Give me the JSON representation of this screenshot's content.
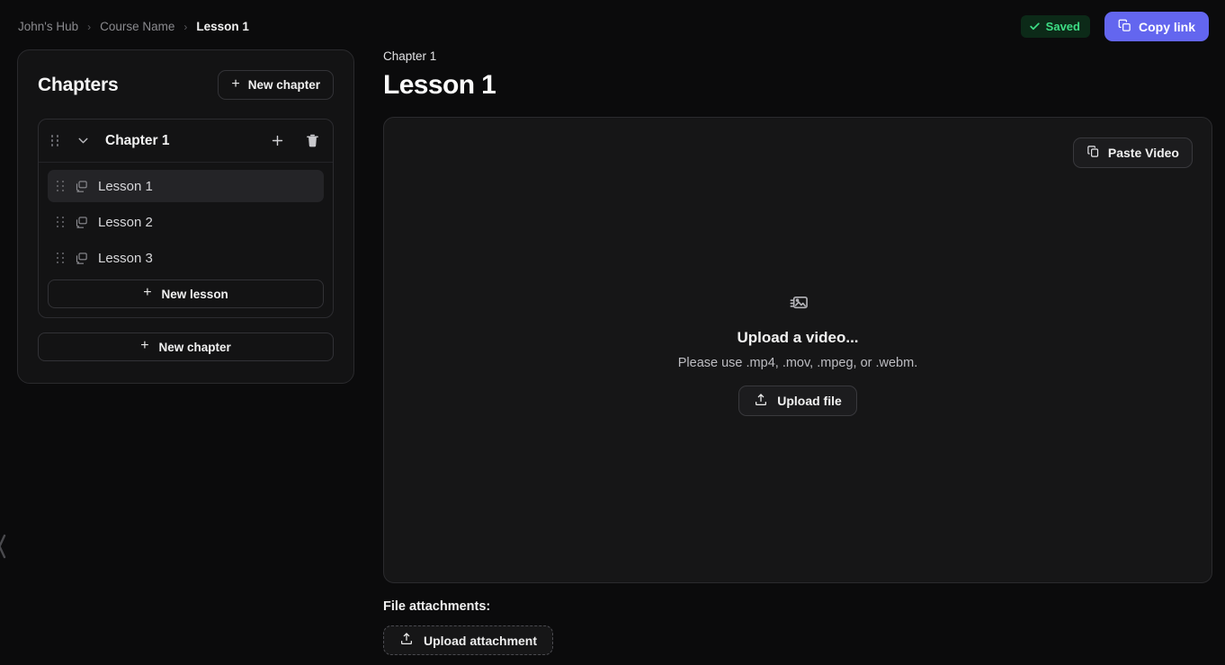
{
  "topbar": {
    "breadcrumb": [
      {
        "label": "John's Hub",
        "current": false
      },
      {
        "label": "Course Name",
        "current": false
      },
      {
        "label": "Lesson 1",
        "current": true
      }
    ],
    "separator": "›",
    "saved_badge": {
      "label": "Saved",
      "icon": "check-icon",
      "text_color": "#3ddc84",
      "bg_color": "#0c2a18"
    },
    "copy_link": {
      "label": "Copy link",
      "icon": "copy-icon",
      "bg_color": "#6366ef",
      "text_color": "#ffffff"
    }
  },
  "sidebar": {
    "title": "Chapters",
    "new_chapter_top_label": "New chapter",
    "new_chapter_bottom_label": "New chapter",
    "plus_glyph": "+",
    "chapter": {
      "name": "Chapter 1",
      "drag_handle_icon": "drag-handle-icon",
      "collapse_icon": "chevron-down-icon",
      "add_icon": "plus-icon",
      "delete_icon": "trash-icon"
    },
    "lessons": [
      {
        "label": "Lesson 1",
        "icon": "gallery-icon",
        "selected": true
      },
      {
        "label": "Lesson 2",
        "icon": "gallery-icon",
        "selected": false
      },
      {
        "label": "Lesson 3",
        "icon": "gallery-icon",
        "selected": false
      }
    ],
    "new_lesson_label": "New lesson",
    "edge_handle_icon": "collapse-handle-icon"
  },
  "main": {
    "eyebrow": "Chapter 1",
    "title": "Lesson 1",
    "paste_video_label": "Paste Video",
    "paste_video_icon": "clipboard-copy-icon",
    "dropzone": {
      "icon": "film-image-icon",
      "title": "Upload a video...",
      "subtitle": "Please use .mp4, .mov, .mpeg, or .webm.",
      "upload_label": "Upload file",
      "upload_icon": "upload-icon"
    },
    "attachments": {
      "label": "File attachments:",
      "upload_label": "Upload attachment",
      "upload_icon": "upload-icon"
    }
  }
}
